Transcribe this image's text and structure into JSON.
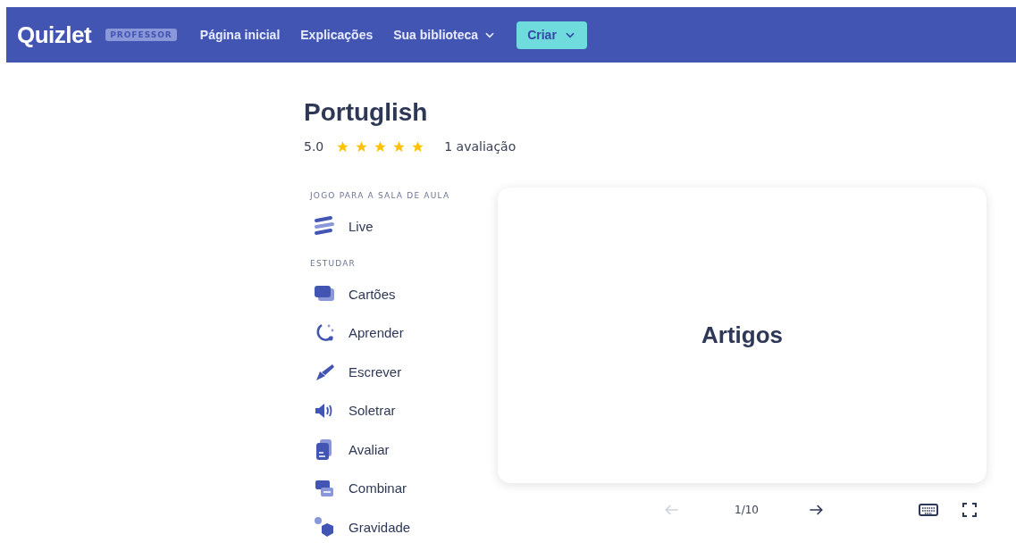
{
  "header": {
    "logo": "Quizlet",
    "badge": "PROFESSOR",
    "nav": [
      {
        "label": "Página inicial",
        "dropdown": false
      },
      {
        "label": "Explicações",
        "dropdown": false
      },
      {
        "label": "Sua biblioteca",
        "dropdown": true
      }
    ],
    "create_button": "Criar"
  },
  "set": {
    "title": "Portuglish",
    "rating": "5.0",
    "stars": 5,
    "reviews": "1 avaliação"
  },
  "sections": [
    {
      "heading": "JOGO PARA A SALA DE AULA",
      "items": [
        {
          "kind": "live",
          "label": "Live"
        }
      ]
    },
    {
      "heading": "ESTUDAR",
      "items": [
        {
          "kind": "cards",
          "label": "Cartões"
        },
        {
          "kind": "learn",
          "label": "Aprender"
        },
        {
          "kind": "write",
          "label": "Escrever"
        },
        {
          "kind": "spell",
          "label": "Soletrar"
        },
        {
          "kind": "test",
          "label": "Avaliar"
        },
        {
          "kind": "match",
          "label": "Combinar"
        },
        {
          "kind": "gravity",
          "label": "Gravidade"
        }
      ]
    }
  ],
  "flashcard": {
    "term": "Artigos",
    "counter": "1/10",
    "prev_disabled": true,
    "next_disabled": false
  }
}
